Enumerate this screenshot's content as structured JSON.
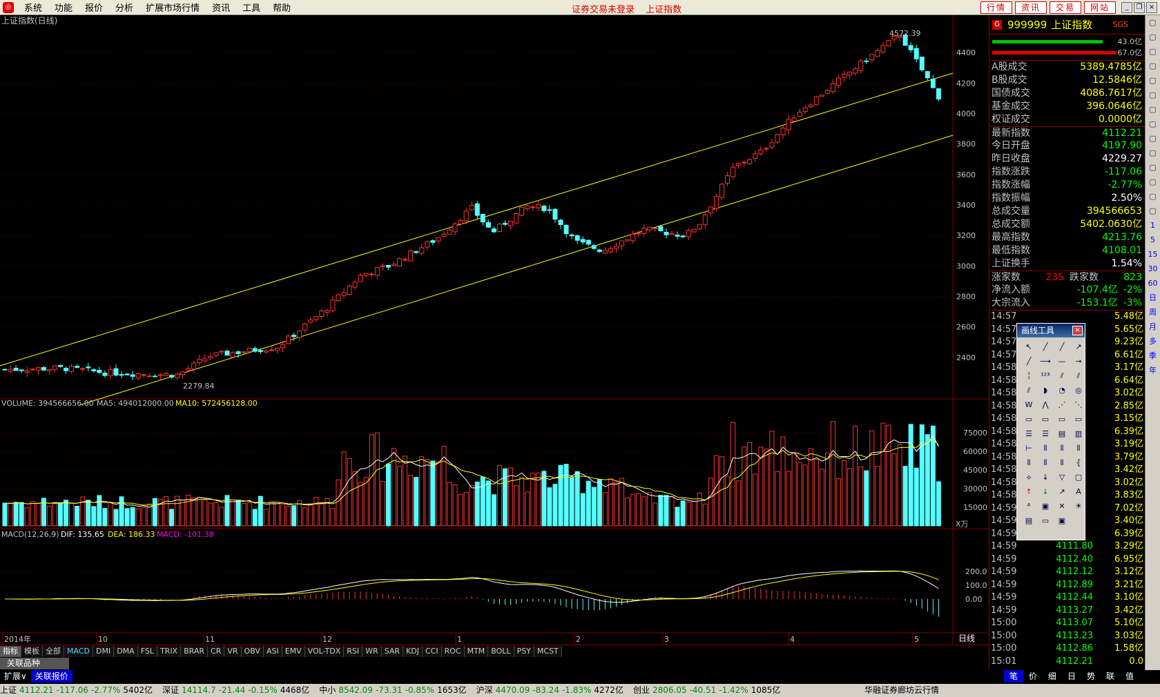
{
  "menu": {
    "items": [
      "系统",
      "功能",
      "报价",
      "分析",
      "扩展市场行情",
      "资讯",
      "工具",
      "帮助"
    ],
    "status_login": "证券交易未登录",
    "status_index": "上证指数",
    "top_buttons": [
      "行情",
      "资讯",
      "交易",
      "网站"
    ]
  },
  "chart": {
    "title": "上证指数(日线)",
    "high_label": "4572.39",
    "low_label": "2279.84",
    "price_ticks": [
      "4400",
      "4200",
      "4000",
      "3800",
      "3600",
      "3400",
      "3200",
      "3000",
      "2800",
      "2600",
      "2400"
    ],
    "volume_header": {
      "volume": "VOLUME: 394566656.00",
      "ma5": "MA5: 494012000.00",
      "ma10": "MA10: 572456128.00"
    },
    "volume_ticks": [
      "75000",
      "60000",
      "45000",
      "30000",
      "15000"
    ],
    "volume_unit": "X万",
    "macd_header": {
      "name": "MACD(12,26,9)",
      "dif": "DIF: 135.65",
      "dea": "DEA: 186.33",
      "macd": "MACD: -101.38"
    },
    "macd_ticks": [
      "200.0",
      "100.0",
      "0.00"
    ],
    "x_labels": [
      "2014年",
      "10",
      "11",
      "12",
      "1",
      "2",
      "3",
      "4",
      "5"
    ],
    "period": "日线"
  },
  "chart_data": {
    "type": "candlestick",
    "title": "上证指数(日线)",
    "ylim": [
      2200,
      4600
    ],
    "series_note": "",
    "anchors": [
      {
        "x": "2014-09",
        "close": 2310
      },
      {
        "x": "2014-10",
        "close": 2330
      },
      {
        "x": "2014-11",
        "close": 2480
      },
      {
        "x": "2014-12",
        "close": 3020
      },
      {
        "x": "2015-01",
        "close": 3330
      },
      {
        "x": "2015-02",
        "close": 3200
      },
      {
        "x": "2015-03",
        "close": 3460
      },
      {
        "x": "2015-04",
        "close": 4200
      },
      {
        "x": "2015-05",
        "close": 4112.21
      }
    ],
    "max": 4572.39,
    "min": 2279.84
  },
  "quote": {
    "code": "999999",
    "name": "上证指数",
    "sgs": "SGS",
    "bar_vals": [
      "43.0亿",
      "67.0亿"
    ],
    "rows": [
      {
        "label": "A股成交",
        "value": "5389.4785亿",
        "color": "#ffff00"
      },
      {
        "label": "B股成交",
        "value": "12.5846亿",
        "color": "#ffff00"
      },
      {
        "label": "国债成交",
        "value": "4086.7617亿",
        "color": "#ffff00"
      },
      {
        "label": "基金成交",
        "value": "396.0646亿",
        "color": "#ffff00"
      },
      {
        "label": "权证成交",
        "value": "0.0000亿",
        "color": "#ffff00"
      },
      {
        "label": "最新指数",
        "value": "4112.21",
        "color": "#00ff00"
      },
      {
        "label": "今日开盘",
        "value": "4197.90",
        "color": "#00ff00"
      },
      {
        "label": "昨日收盘",
        "value": "4229.27",
        "color": "#ffffff"
      },
      {
        "label": "指数涨跌",
        "value": "-117.06",
        "color": "#00ff00"
      },
      {
        "label": "指数涨幅",
        "value": "-2.77%",
        "color": "#00ff00"
      },
      {
        "label": "指数振幅",
        "value": "2.50%",
        "color": "#ffffff"
      },
      {
        "label": "总成交量",
        "value": "394566653",
        "color": "#ffff00"
      },
      {
        "label": "总成交额",
        "value": "5402.0630亿",
        "color": "#ffff00"
      },
      {
        "label": "最高指数",
        "value": "4213.76",
        "color": "#00ff00"
      },
      {
        "label": "最低指数",
        "value": "4108.01",
        "color": "#00ff00"
      },
      {
        "label": "上证换手",
        "value": "1.54%",
        "color": "#ffffff"
      }
    ],
    "up_label": "涨家数",
    "up_val": "235",
    "down_label": "跌家数",
    "down_val": "823",
    "flow": [
      {
        "label": "净流入额",
        "value": "-107.4亿",
        "pct": "-2%"
      },
      {
        "label": "大宗流入",
        "value": "-153.1亿",
        "pct": "-3%"
      }
    ],
    "ticks": [
      {
        "t": "14:57",
        "p": "",
        "v": "5.48亿"
      },
      {
        "t": "14:57",
        "p": "",
        "v": "5.65亿"
      },
      {
        "t": "14:57",
        "p": "",
        "v": "9.23亿"
      },
      {
        "t": "14:57",
        "p": "",
        "v": "6.61亿"
      },
      {
        "t": "14:58",
        "p": "",
        "v": "3.17亿"
      },
      {
        "t": "14:58",
        "p": "",
        "v": "6.64亿"
      },
      {
        "t": "14:58",
        "p": "",
        "v": "3.02亿"
      },
      {
        "t": "14:58",
        "p": "",
        "v": "2.85亿"
      },
      {
        "t": "14:58",
        "p": "",
        "v": "3.15亿"
      },
      {
        "t": "14:58",
        "p": "",
        "v": "6.39亿"
      },
      {
        "t": "14:58",
        "p": "",
        "v": "3.19亿"
      },
      {
        "t": "14:58",
        "p": "",
        "v": "3.79亿"
      },
      {
        "t": "14:58",
        "p": "",
        "v": "3.42亿"
      },
      {
        "t": "14:58",
        "p": "",
        "v": "3.02亿"
      },
      {
        "t": "14:58",
        "p": "",
        "v": "3.83亿"
      },
      {
        "t": "14:59",
        "p": "",
        "v": "7.02亿"
      },
      {
        "t": "14:59",
        "p": "",
        "v": "3.40亿"
      },
      {
        "t": "14:59",
        "p": "",
        "v": "6.39亿"
      },
      {
        "t": "14:59",
        "p": "4111.80",
        "v": "3.29亿"
      },
      {
        "t": "14:59",
        "p": "4112.40",
        "v": "6.95亿"
      },
      {
        "t": "14:59",
        "p": "4112.12",
        "v": "3.12亿"
      },
      {
        "t": "14:59",
        "p": "4112.89",
        "v": "3.21亿"
      },
      {
        "t": "14:59",
        "p": "4112.44",
        "v": "3.10亿"
      },
      {
        "t": "14:59",
        "p": "4113.27",
        "v": "3.42亿"
      },
      {
        "t": "15:00",
        "p": "4113.07",
        "v": "5.10亿"
      },
      {
        "t": "15:00",
        "p": "4113.23",
        "v": "3.03亿"
      },
      {
        "t": "15:00",
        "p": "4112.86",
        "v": "1.58亿"
      },
      {
        "t": "15:01",
        "p": "4112.21",
        "v": "0.0"
      }
    ]
  },
  "draw_tools": {
    "title": "画线工具",
    "close": "×"
  },
  "indicator_tabs": [
    "指标",
    "模板",
    "全部",
    "MACD",
    "DMI",
    "DMA",
    "FSL",
    "TRIX",
    "BRAR",
    "CR",
    "VR",
    "OBV",
    "ASI",
    "EMV",
    "VOL-TDX",
    "RSI",
    "WR",
    "SAR",
    "KDJ",
    "CCI",
    "ROC",
    "MTM",
    "BOLL",
    "PSY",
    "MCST"
  ],
  "related": "关联品种",
  "bottom_tabs": [
    "扩展∨",
    "关联报价"
  ],
  "bottom_right_tabs": [
    "笔",
    "价",
    "细",
    "日",
    "势",
    "联",
    "值"
  ],
  "sidebar": [
    "1",
    "5",
    "15",
    "30",
    "60",
    "日",
    "周",
    "月",
    "多",
    "季",
    "年"
  ],
  "status": [
    {
      "name": "上证",
      "val": "4112.21",
      "chg": "-117.06",
      "pct": "-2.77%",
      "amt": "5402亿"
    },
    {
      "name": "深证",
      "val": "14114.7",
      "chg": "-21.44",
      "pct": "-0.15%",
      "amt": "4468亿"
    },
    {
      "name": "中小",
      "val": "8542.09",
      "chg": "-73.31",
      "pct": "-0.85%",
      "amt": "1653亿"
    },
    {
      "name": "沪深",
      "val": "4470.09",
      "chg": "-83.24",
      "pct": "-1.83%",
      "amt": "4272亿"
    },
    {
      "name": "创业",
      "val": "2806.05",
      "chg": "-40.51",
      "pct": "-1.42%",
      "amt": "1085亿"
    }
  ],
  "broker": "华融证券廊坊云行情"
}
